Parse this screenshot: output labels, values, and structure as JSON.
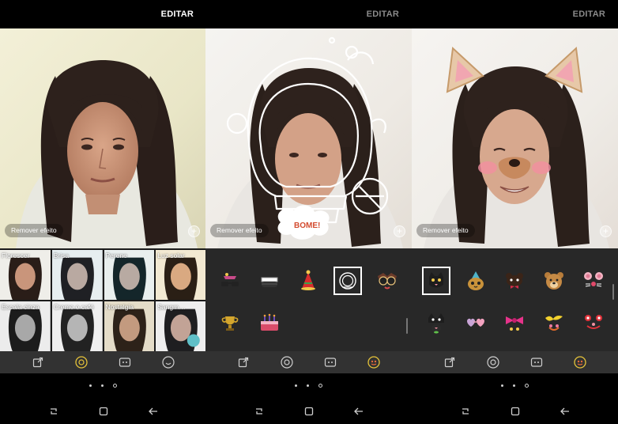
{
  "screens": [
    {
      "title": "EDITAR",
      "remove_label": "Remover efeito",
      "plus_label": "+",
      "filters": [
        {
          "label": "Florescer"
        },
        {
          "label": "Brisa"
        },
        {
          "label": "Perene"
        },
        {
          "label": "Luz solar"
        },
        {
          "label": "Escala cinza"
        },
        {
          "label": "Creme e café"
        },
        {
          "label": "Nostalgia"
        },
        {
          "label": "Sangm…"
        }
      ],
      "active_tool": "filter-tool"
    },
    {
      "title": "EDITAR",
      "remove_label": "Remover efeito",
      "plus_label": "+",
      "stickers": [
        "sunglasses-hat",
        "ski-goggles",
        "party-hat",
        "astronaut-helmet",
        "owl-glasses",
        "trophy",
        "birthday-cake"
      ],
      "selected_sticker": 3,
      "active_tool": "sticker-tool"
    },
    {
      "title": "EDITAR",
      "remove_label": "Remover efeito",
      "plus_label": "+",
      "stickers": [
        "cat-face",
        "party-cat",
        "bear-bow",
        "teddy-bear",
        "pink-mouse",
        "black-cat",
        "heart-glasses",
        "pink-bow",
        "yellow-bow",
        "red-crab"
      ],
      "selected_sticker": 0,
      "active_tool": "sticker-tool"
    }
  ],
  "toolbar_icons": [
    "export-icon",
    "filter-icon",
    "face-icon",
    "sticker-icon"
  ],
  "nav_icons": [
    "recent-apps-icon",
    "home-icon",
    "back-icon"
  ],
  "page_dots": 3,
  "colors": {
    "accent": "#e5c33a",
    "panel": "#282828",
    "toolbar": "#323232"
  }
}
